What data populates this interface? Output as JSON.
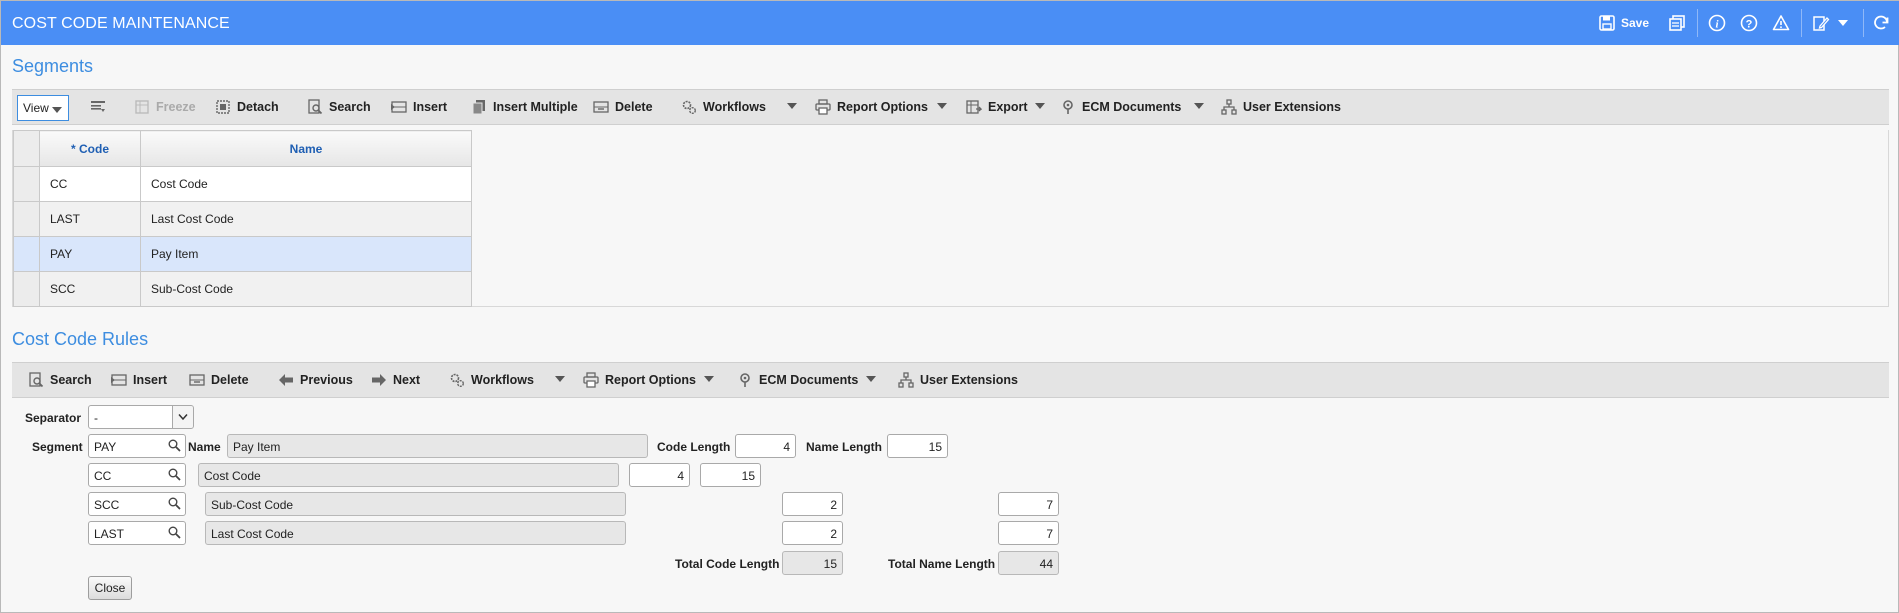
{
  "app": {
    "title": "COST CODE MAINTENANCE",
    "save_label": "Save"
  },
  "segments": {
    "title": "Segments",
    "view_label": "View",
    "toolbar": {
      "freeze": "Freeze",
      "detach": "Detach",
      "search": "Search",
      "insert": "Insert",
      "insert_multiple": "Insert Multiple",
      "delete": "Delete",
      "workflows": "Workflows",
      "report_options": "Report Options",
      "export": "Export",
      "ecm_documents": "ECM Documents",
      "user_extensions": "User Extensions"
    },
    "columns": [
      "* Code",
      "Name"
    ],
    "rows": [
      {
        "code": "CC",
        "name": "Cost Code"
      },
      {
        "code": "LAST",
        "name": "Last Cost Code"
      },
      {
        "code": "PAY",
        "name": "Pay Item"
      },
      {
        "code": "SCC",
        "name": "Sub-Cost Code"
      }
    ]
  },
  "rules": {
    "title": "Cost Code Rules",
    "toolbar": {
      "search": "Search",
      "insert": "Insert",
      "delete": "Delete",
      "previous": "Previous",
      "next": "Next",
      "workflows": "Workflows",
      "report_options": "Report Options",
      "ecm_documents": "ECM Documents",
      "user_extensions": "User Extensions"
    },
    "form": {
      "separator_label": "Separator",
      "separator_value": "-",
      "segment_label": "Segment",
      "name_label": "Name",
      "code_length_label": "Code Length",
      "name_length_label": "Name Length",
      "total_code_length_label": "Total Code Length",
      "total_name_length_label": "Total Name Length",
      "total_code_length": "15",
      "total_name_length": "44",
      "close_label": "Close",
      "segments": [
        {
          "code": "PAY",
          "name": "Pay Item",
          "code_length": "4",
          "name_length": "15"
        },
        {
          "code": "CC",
          "name": "Cost Code",
          "code_length": "4",
          "name_length": "15"
        },
        {
          "code": "SCC",
          "name": "Sub-Cost Code",
          "code_length": "2",
          "name_length": "7"
        },
        {
          "code": "LAST",
          "name": "Last Cost Code",
          "code_length": "2",
          "name_length": "7"
        }
      ]
    }
  },
  "colors": {
    "title_bar": "#4a8ef5",
    "section_title": "#3d8de0",
    "selected_row": "#d9e6fb"
  }
}
